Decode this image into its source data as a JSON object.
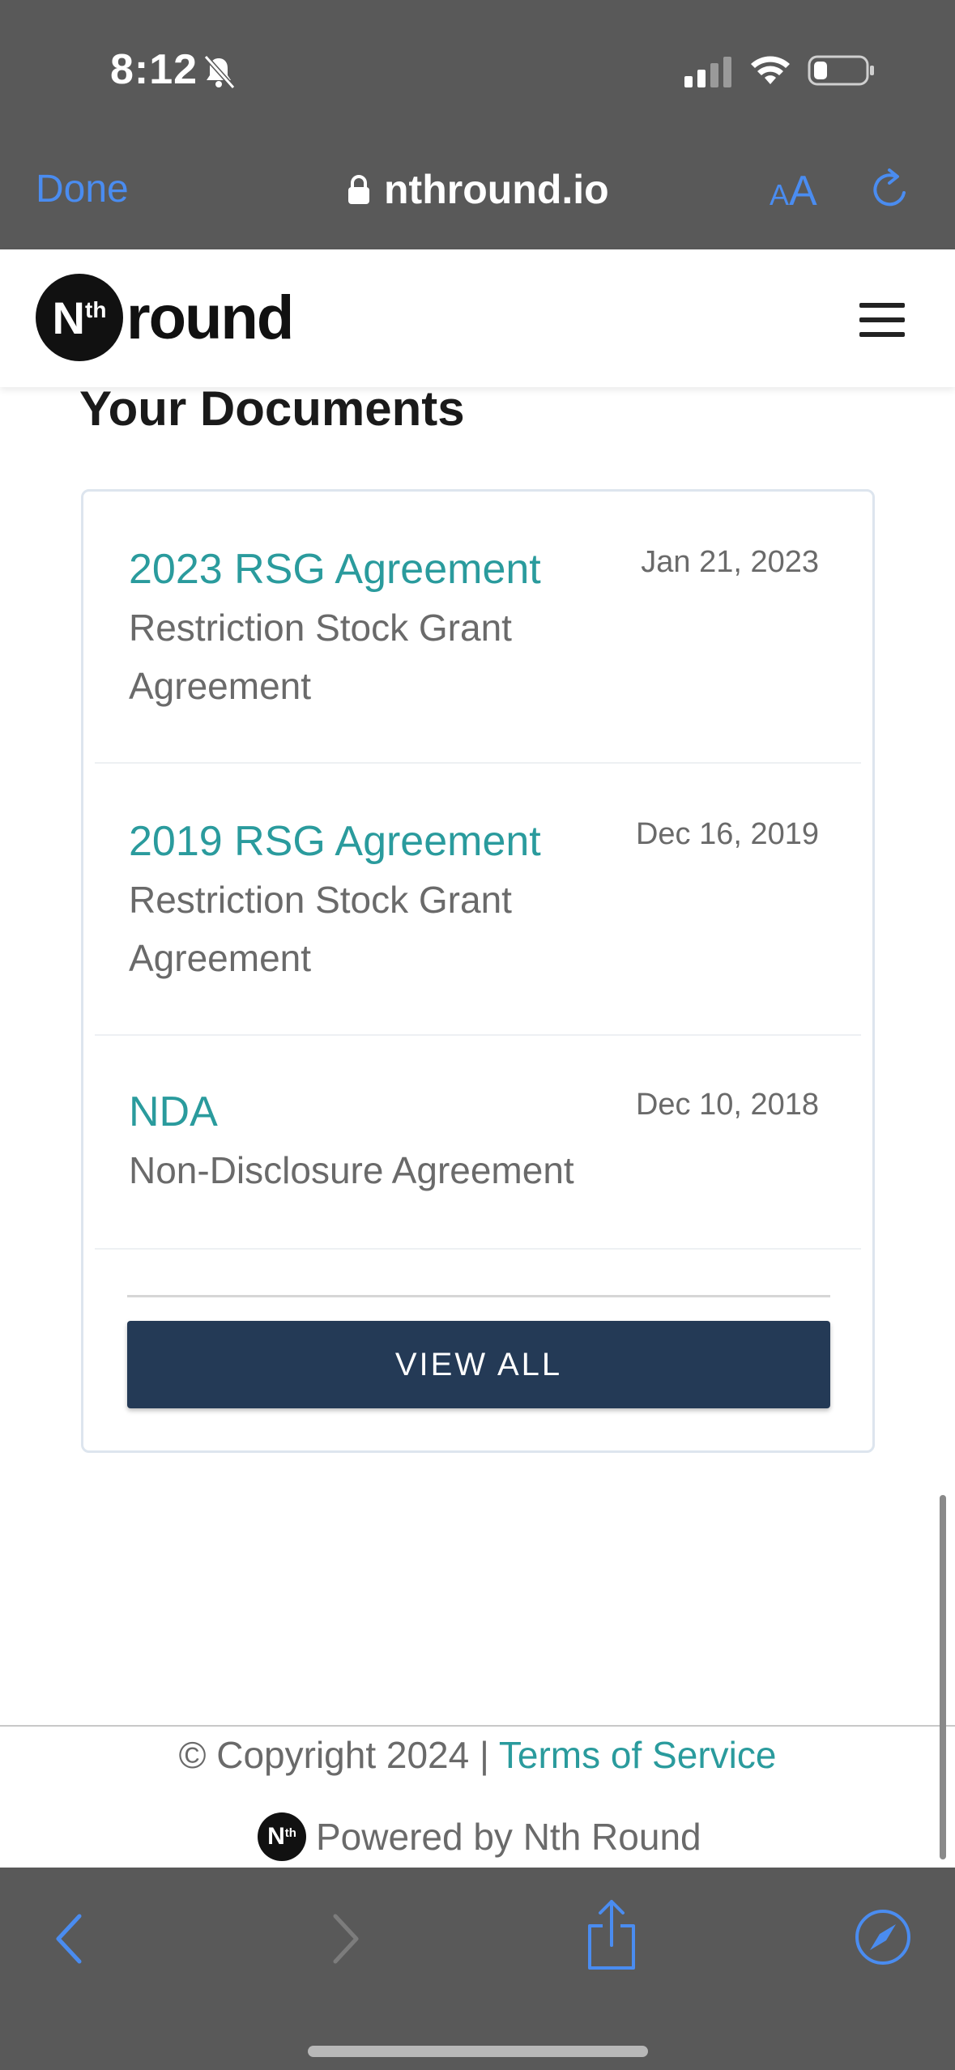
{
  "status_bar": {
    "time": "8:12"
  },
  "browser": {
    "done_label": "Done",
    "url": "nthround.io",
    "text_size_small": "A",
    "text_size_big": "A"
  },
  "site": {
    "logo_letter": "N",
    "logo_sup": "th",
    "logo_word": "round"
  },
  "documents": {
    "title": "Your Documents",
    "items": [
      {
        "name": "2023 RSG Agreement",
        "description": "Restriction Stock Grant Agreement",
        "date": "Jan 21, 2023"
      },
      {
        "name": "2019 RSG Agreement",
        "description": "Restriction Stock Grant Agreement",
        "date": "Dec 16, 2019"
      },
      {
        "name": "NDA",
        "description": "Non-Disclosure Agreement",
        "date": "Dec 10, 2018"
      }
    ],
    "view_all_label": "VIEW ALL"
  },
  "footer": {
    "copyright": "© Copyright 2024 | ",
    "terms_label": "Terms of Service",
    "powered_logo_letter": "N",
    "powered_logo_sup": "th",
    "powered_by": "Powered by Nth Round"
  },
  "colors": {
    "accent_teal": "#2a9b9d",
    "button_navy": "#243a56",
    "safari_blue": "#4a8cf0",
    "chrome_gray": "#595959"
  },
  "icons": [
    "bell-slash-icon",
    "signal-icon",
    "wifi-icon",
    "battery-icon",
    "lock-icon",
    "reload-icon",
    "hamburger-icon",
    "back-icon",
    "forward-icon",
    "share-icon",
    "compass-icon"
  ]
}
